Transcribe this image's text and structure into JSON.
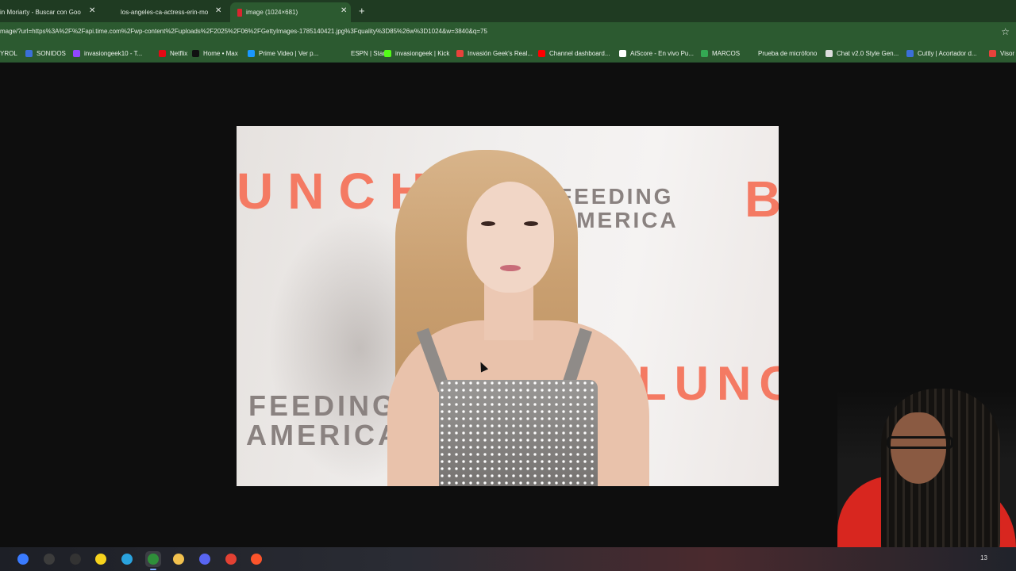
{
  "tabs": [
    {
      "title": "in Moriarty - Buscar con Goo",
      "close": "✕"
    },
    {
      "title": "los-angeles-ca-actress-erin-mo",
      "close": "✕"
    },
    {
      "title": "image (1024×681)",
      "close": "✕",
      "active": true
    }
  ],
  "new_tab_label": "+",
  "address": {
    "url": "mage/?url=https%3A%2F%2Fapi.time.com%2Fwp-content%2Fuploads%2F2025%2F06%2FGettyImages-1785140421.jpg%3Fquality%3D85%26w%3D1024&w=3840&q=75",
    "star_icon": "☆"
  },
  "bookmarks": [
    {
      "label": "YROL",
      "color": "#2c5a30"
    },
    {
      "label": "SONIDOS",
      "color": "#3b6fd8"
    },
    {
      "label": "invasiongeek10 - T...",
      "color": "#9146ff"
    },
    {
      "label": "Netflix",
      "color": "#e50914"
    },
    {
      "label": "Home • Max",
      "color": "#111111"
    },
    {
      "label": "Prime Video | Ver p...",
      "color": "#1a98ff"
    },
    {
      "label": "ESPN | Star+",
      "color": "#2c5a30"
    },
    {
      "label": "invasiongeek | Kick",
      "color": "#53fc18"
    },
    {
      "label": "Invasión Geek's Real...",
      "color": "#e8423b"
    },
    {
      "label": "Channel dashboard...",
      "color": "#ff0000"
    },
    {
      "label": "AiScore - En vivo Pu...",
      "color": "#ffffff"
    },
    {
      "label": "MARCOS",
      "color": "#34a853"
    },
    {
      "label": "Prueba de micrófono",
      "color": "#2c5a30"
    },
    {
      "label": "Chat v2.0 Style Gen...",
      "color": "#dddddd"
    },
    {
      "label": "Cuttly | Acortador d...",
      "color": "#3b6fd8"
    },
    {
      "label": "Visor",
      "color": "#e8423b"
    }
  ],
  "photo": {
    "bg_text_left": "UNCH",
    "bg_text_right_top": "B",
    "bg_text_right": "XLUNCH",
    "feeding_top": "FEEDING",
    "america_top": "AMERICA",
    "feeding_bottom": "FEEDING",
    "america_bottom": "AMERICA"
  },
  "taskbar": {
    "apps": [
      {
        "name": "copilot-icon",
        "color": "#3a7bff",
        "active": false
      },
      {
        "name": "obs-icon",
        "color": "#3c3c3c",
        "active": false
      },
      {
        "name": "speedometer-icon",
        "color": "#333333",
        "active": false
      },
      {
        "name": "sticky-notes-icon",
        "color": "#f7d31d",
        "active": false
      },
      {
        "name": "telegram-icon",
        "color": "#2aa3de",
        "active": false
      },
      {
        "name": "chrome-icon",
        "color": "#2f8f3a",
        "active": true
      },
      {
        "name": "file-explorer-icon",
        "color": "#f2c14e",
        "active": false
      },
      {
        "name": "discord-icon",
        "color": "#5865f2",
        "active": false
      },
      {
        "name": "chrome-alt-icon",
        "color": "#e34133",
        "active": false
      },
      {
        "name": "brave-icon",
        "color": "#fb542b",
        "active": false
      }
    ],
    "tray_number": "13"
  }
}
